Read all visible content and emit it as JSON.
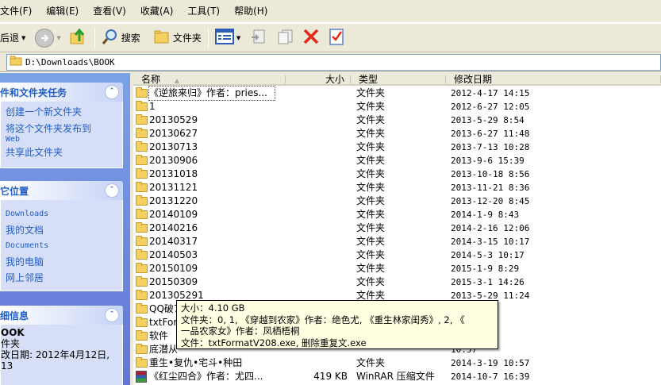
{
  "menubar": {
    "items": [
      "文件(F)",
      "编辑(E)",
      "查看(V)",
      "收藏(A)",
      "工具(T)",
      "帮助(H)"
    ]
  },
  "toolbar": {
    "back_label": "后退",
    "search_label": "搜索",
    "folders_label": "文件夹"
  },
  "address": {
    "path": "D:\\Downloads\\BOOK"
  },
  "taskpane": {
    "tasks": {
      "title": "件和文件夹任务",
      "links": [
        "创建一个新文件夹",
        "将这个文件夹发布到",
        "Web",
        "共享此文件夹"
      ]
    },
    "places": {
      "title": "它位置",
      "links": [
        "Downloads",
        "我的文档",
        "Documents",
        "我的电脑",
        "网上邻居"
      ]
    },
    "details": {
      "title": "细信息",
      "name": "OOK",
      "kind": "件夹",
      "modified": "改日期: 2012年4月12日,",
      "time": "13"
    }
  },
  "columns": {
    "name": "名称",
    "size": "大小",
    "type": "类型",
    "date": "修改日期"
  },
  "files": [
    {
      "name": "《逆旅来归》作者：pries...",
      "size": "",
      "type": "文件夹",
      "date": "2012-4-17 14:15",
      "icon": "folder"
    },
    {
      "name": "1",
      "size": "",
      "type": "文件夹",
      "date": "2012-6-27 12:05",
      "icon": "folder"
    },
    {
      "name": "20130529",
      "size": "",
      "type": "文件夹",
      "date": "2013-5-29 8:54",
      "icon": "folder"
    },
    {
      "name": "20130627",
      "size": "",
      "type": "文件夹",
      "date": "2013-6-27 11:48",
      "icon": "folder"
    },
    {
      "name": "20130713",
      "size": "",
      "type": "文件夹",
      "date": "2013-7-13 10:28",
      "icon": "folder"
    },
    {
      "name": "20130906",
      "size": "",
      "type": "文件夹",
      "date": "2013-9-6 15:39",
      "icon": "folder"
    },
    {
      "name": "20131018",
      "size": "",
      "type": "文件夹",
      "date": "2013-10-18 8:56",
      "icon": "folder"
    },
    {
      "name": "20131121",
      "size": "",
      "type": "文件夹",
      "date": "2013-11-21 8:36",
      "icon": "folder"
    },
    {
      "name": "20131220",
      "size": "",
      "type": "文件夹",
      "date": "2013-12-20 8:45",
      "icon": "folder"
    },
    {
      "name": "20140109",
      "size": "",
      "type": "文件夹",
      "date": "2014-1-9 8:43",
      "icon": "folder"
    },
    {
      "name": "20140216",
      "size": "",
      "type": "文件夹",
      "date": "2014-2-16 12:06",
      "icon": "folder"
    },
    {
      "name": "20140317",
      "size": "",
      "type": "文件夹",
      "date": "2014-3-15 10:17",
      "icon": "folder"
    },
    {
      "name": "20140503",
      "size": "",
      "type": "文件夹",
      "date": "2014-5-3 10:17",
      "icon": "folder"
    },
    {
      "name": "20150109",
      "size": "",
      "type": "文件夹",
      "date": "2015-1-9 8:29",
      "icon": "folder"
    },
    {
      "name": "20150309",
      "size": "",
      "type": "文件夹",
      "date": "2015-3-1 14:26",
      "icon": "folder"
    },
    {
      "name": "201305291",
      "size": "",
      "type": "文件夹",
      "date": "2013-5-29 11:24",
      "icon": "folder"
    },
    {
      "name": "QQ破7",
      "size": "",
      "type": "",
      "date": "12:56",
      "icon": "folder"
    },
    {
      "name": "txtFor",
      "size": "",
      "type": "",
      "date": "14:43",
      "icon": "folder"
    },
    {
      "name": "软件",
      "size": "",
      "type": "",
      "date": "10:36",
      "icon": "folder"
    },
    {
      "name": "底潜从",
      "size": "",
      "type": "",
      "date": "10:57",
      "icon": "folder"
    },
    {
      "name": "重生•复仇•宅斗•种田",
      "size": "",
      "type": "文件夹",
      "date": "2014-3-19 10:57",
      "icon": "folder"
    },
    {
      "name": "《红尘四合》作者：尤四...",
      "size": "419 KB",
      "type": "WinRAR 压缩文件",
      "date": "2014-10-7 16:39",
      "icon": "rar"
    }
  ],
  "tooltip": {
    "line1": "大小：4.10 GB",
    "line2": "文件夹：0, 1, 《穿越到农家》作者：绝色尤, 《重生林家闺秀》, 2, 《",
    "line3": "一品农家女》作者：凤栖梧桐",
    "line4": "文件：txtFormatV208.exe, 删除重复文.exe"
  },
  "colors": {
    "pane_gradient_top": "#7ba2e7",
    "pane_gradient_bottom": "#6375d6",
    "link_blue": "#215dc6",
    "chrome": "#ece9d8",
    "tooltip_bg": "#ffffe1"
  }
}
